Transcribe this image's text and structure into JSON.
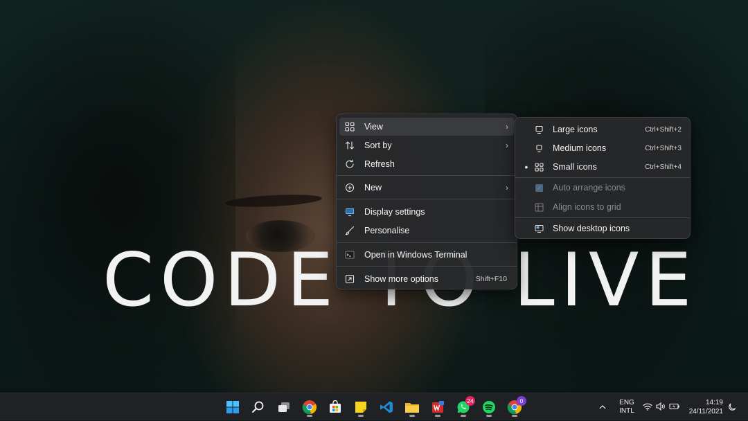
{
  "wallpaper": {
    "headline": "CODE TO LIVE"
  },
  "context_menu": {
    "items": [
      {
        "id": "view",
        "icon": "grid-icon",
        "label": "View",
        "submenu": true
      },
      {
        "id": "sort",
        "icon": "sort-icon",
        "label": "Sort by",
        "submenu": true
      },
      {
        "id": "refresh",
        "icon": "refresh-icon",
        "label": "Refresh"
      },
      {
        "id": "new",
        "icon": "plus-circle-icon",
        "label": "New",
        "submenu": true
      },
      {
        "id": "display",
        "icon": "display-icon",
        "label": "Display settings"
      },
      {
        "id": "personalise",
        "icon": "brush-icon",
        "label": "Personalise"
      },
      {
        "id": "terminal",
        "icon": "terminal-icon",
        "label": "Open in Windows Terminal"
      },
      {
        "id": "more",
        "icon": "expand-icon",
        "label": "Show more options",
        "shortcut": "Shift+F10"
      }
    ]
  },
  "view_submenu": {
    "items": [
      {
        "id": "large",
        "icon": "monitor-icon",
        "label": "Large icons",
        "shortcut": "Ctrl+Shift+2",
        "selected": false
      },
      {
        "id": "medium",
        "icon": "monitor-icon",
        "label": "Medium icons",
        "shortcut": "Ctrl+Shift+3",
        "selected": false
      },
      {
        "id": "small",
        "icon": "grid-icon",
        "label": "Small icons",
        "shortcut": "Ctrl+Shift+4",
        "selected": true,
        "marker": "•"
      },
      {
        "id": "auto",
        "icon": "auto-arrange-icon",
        "label": "Auto arrange icons",
        "disabled": true
      },
      {
        "id": "align",
        "icon": "align-grid-icon",
        "label": "Align icons to grid",
        "disabled": true
      },
      {
        "id": "show",
        "icon": "desktop-icon",
        "label": "Show desktop icons"
      }
    ]
  },
  "taskbar": {
    "apps": [
      {
        "id": "start",
        "icon": "windows-start-icon"
      },
      {
        "id": "search",
        "icon": "search-icon"
      },
      {
        "id": "taskview",
        "icon": "task-view-icon"
      },
      {
        "id": "chrome",
        "icon": "chrome-icon",
        "running": true
      },
      {
        "id": "store",
        "icon": "store-icon"
      },
      {
        "id": "notes",
        "icon": "sticky-notes-icon",
        "running": true
      },
      {
        "id": "vscode",
        "icon": "vscode-icon"
      },
      {
        "id": "explorer",
        "icon": "file-explorer-icon",
        "running": true
      },
      {
        "id": "wps",
        "icon": "wps-office-icon",
        "running": true
      },
      {
        "id": "whatsapp",
        "icon": "whatsapp-icon",
        "badge": "24",
        "running": true
      },
      {
        "id": "spotify",
        "icon": "spotify-icon",
        "running": true
      },
      {
        "id": "chrome2",
        "icon": "chrome-profile-icon",
        "badge": "0",
        "running": true
      }
    ],
    "tray": {
      "lang_top": "ENG",
      "lang_bottom": "INTL",
      "time": "14:19",
      "date": "24/11/2021"
    }
  },
  "colors": {
    "menu_bg": "#28292b",
    "taskbar_bg": "#202124",
    "whatsapp_badge": "#e0245e",
    "profile_badge": "#7b3fd1"
  }
}
